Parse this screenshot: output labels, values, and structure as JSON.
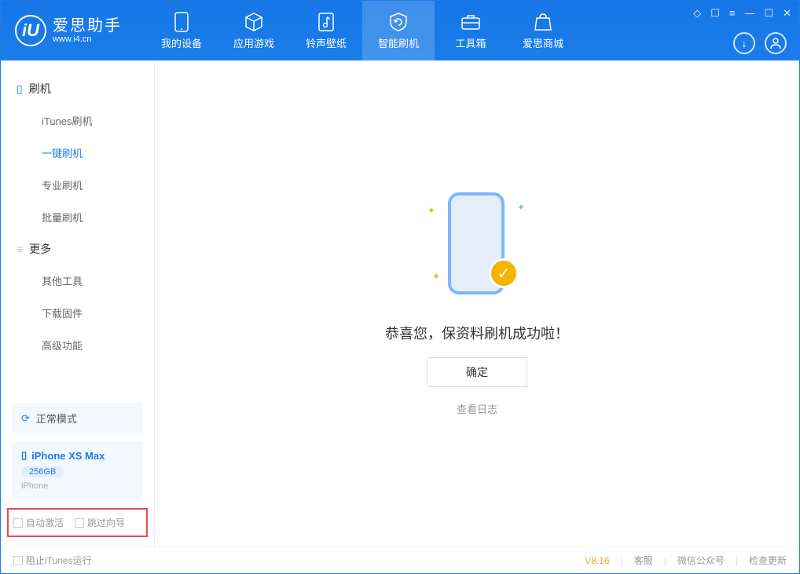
{
  "app": {
    "name": "爱思助手",
    "subtitle": "www.i4.cn",
    "logo_letter": "iU"
  },
  "nav": {
    "tabs": [
      {
        "label": "我的设备"
      },
      {
        "label": "应用游戏"
      },
      {
        "label": "铃声壁纸"
      },
      {
        "label": "智能刷机"
      },
      {
        "label": "工具箱"
      },
      {
        "label": "爱思商城"
      }
    ]
  },
  "sidebar": {
    "group1_title": "刷机",
    "items1": [
      {
        "label": "iTunes刷机"
      },
      {
        "label": "一键刷机"
      },
      {
        "label": "专业刷机"
      },
      {
        "label": "批量刷机"
      }
    ],
    "group2_title": "更多",
    "items2": [
      {
        "label": "其他工具"
      },
      {
        "label": "下载固件"
      },
      {
        "label": "高级功能"
      }
    ],
    "mode_label": "正常模式",
    "device": {
      "name": "iPhone XS Max",
      "capacity": "256GB",
      "type": "iPhone"
    },
    "opt_auto_activate": "自动激活",
    "opt_skip_guide": "跳过向导"
  },
  "main": {
    "success_text": "恭喜您，保资料刷机成功啦！",
    "ok_label": "确定",
    "log_link": "查看日志"
  },
  "footer": {
    "block_itunes": "阻止iTunes运行",
    "version": "V8.16",
    "links": [
      "客服",
      "微信公众号",
      "检查更新"
    ]
  }
}
